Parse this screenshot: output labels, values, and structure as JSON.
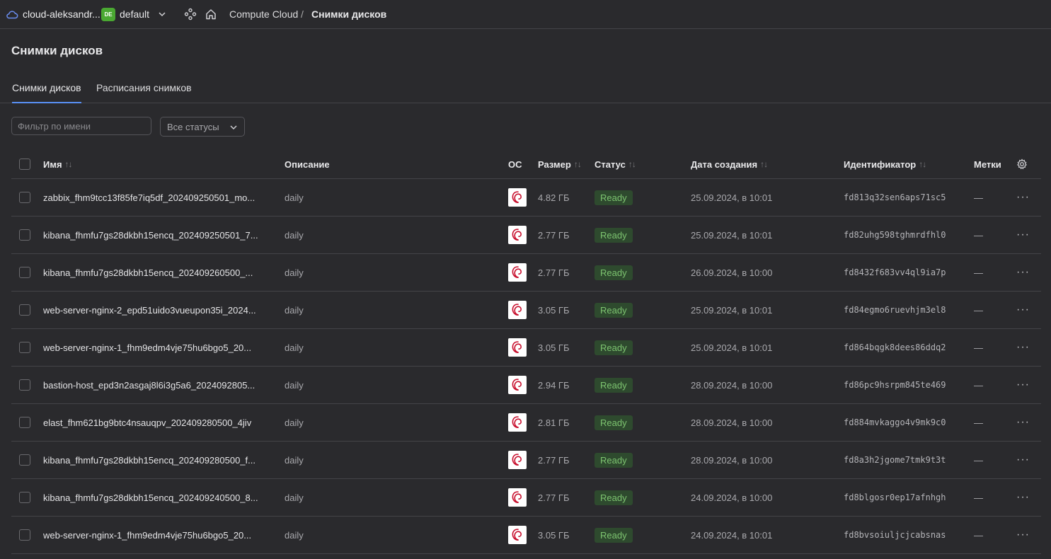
{
  "header": {
    "cloud_name": "cloud-aleksandr...",
    "folder_badge": "DE",
    "folder_name": "default",
    "breadcrumb_service": "Compute Cloud",
    "breadcrumb_sep": "/",
    "breadcrumb_current": "Снимки дисков"
  },
  "page_title": "Снимки дисков",
  "tabs": [
    {
      "label": "Снимки дисков",
      "active": true
    },
    {
      "label": "Расписания снимков",
      "active": false
    }
  ],
  "filters": {
    "name_placeholder": "Фильтр по имени",
    "status_select": "Все статусы"
  },
  "table": {
    "columns": {
      "name": "Имя",
      "description": "Описание",
      "os": "ОС",
      "size": "Размер",
      "status": "Статус",
      "created": "Дата создания",
      "id": "Идентификатор",
      "labels": "Метки"
    },
    "sort_glyph": "↑↓",
    "rows": [
      {
        "name": "zabbix_fhm9tcc13f85fe7iq5df_202409250501_mo...",
        "description": "daily",
        "os": "debian-icon",
        "size": "4.82 ГБ",
        "status": "Ready",
        "created": "25.09.2024, в 10:01",
        "id": "fd813q32sen6aps71sc5",
        "labels": "—"
      },
      {
        "name": "kibana_fhmfu7gs28dkbh15encq_202409250501_7...",
        "description": "daily",
        "os": "debian-icon",
        "size": "2.77 ГБ",
        "status": "Ready",
        "created": "25.09.2024, в 10:01",
        "id": "fd82uhg598tghmrdfhl0",
        "labels": "—"
      },
      {
        "name": "kibana_fhmfu7gs28dkbh15encq_202409260500_...",
        "description": "daily",
        "os": "debian-icon",
        "size": "2.77 ГБ",
        "status": "Ready",
        "created": "26.09.2024, в 10:00",
        "id": "fd8432f683vv4ql9ia7p",
        "labels": "—"
      },
      {
        "name": "web-server-nginx-2_epd51uido3vueupon35i_2024...",
        "description": "daily",
        "os": "debian-icon",
        "size": "3.05 ГБ",
        "status": "Ready",
        "created": "25.09.2024, в 10:01",
        "id": "fd84egmo6ruevhjm3el8",
        "labels": "—"
      },
      {
        "name": "web-server-nginx-1_fhm9edm4vje75hu6bgo5_20...",
        "description": "daily",
        "os": "debian-icon",
        "size": "3.05 ГБ",
        "status": "Ready",
        "created": "25.09.2024, в 10:01",
        "id": "fd864bqgk8dees86ddq2",
        "labels": "—"
      },
      {
        "name": "bastion-host_epd3n2asgaj8l6i3g5a6_2024092805...",
        "description": "daily",
        "os": "debian-icon",
        "size": "2.94 ГБ",
        "status": "Ready",
        "created": "28.09.2024, в 10:00",
        "id": "fd86pc9hsrpm845te469",
        "labels": "—"
      },
      {
        "name": "elast_fhm621bg9btc4nsauqpv_202409280500_4jiv",
        "description": "daily",
        "os": "debian-icon",
        "size": "2.81 ГБ",
        "status": "Ready",
        "created": "28.09.2024, в 10:00",
        "id": "fd884mvkaggo4v9mk9c0",
        "labels": "—"
      },
      {
        "name": "kibana_fhmfu7gs28dkbh15encq_202409280500_f...",
        "description": "daily",
        "os": "debian-icon",
        "size": "2.77 ГБ",
        "status": "Ready",
        "created": "28.09.2024, в 10:00",
        "id": "fd8a3h2jgome7tmk9t3t",
        "labels": "—"
      },
      {
        "name": "kibana_fhmfu7gs28dkbh15encq_202409240500_8...",
        "description": "daily",
        "os": "debian-icon",
        "size": "2.77 ГБ",
        "status": "Ready",
        "created": "24.09.2024, в 10:00",
        "id": "fd8blgosr0ep17afnhgh",
        "labels": "—"
      },
      {
        "name": "web-server-nginx-1_fhm9edm4vje75hu6bgo5_20...",
        "description": "daily",
        "os": "debian-icon",
        "size": "3.05 ГБ",
        "status": "Ready",
        "created": "24.09.2024, в 10:01",
        "id": "fd8bvsoiuljcjcabsnas",
        "labels": "—"
      }
    ],
    "row_menu_glyph": "···"
  },
  "colors": {
    "background": "#2a2a2d",
    "accent": "#5990f5",
    "status_ready_bg": "#2e4a2e",
    "status_ready_text": "#7dc470",
    "folder_badge": "#4aa832",
    "debian_red": "#c8102e"
  }
}
